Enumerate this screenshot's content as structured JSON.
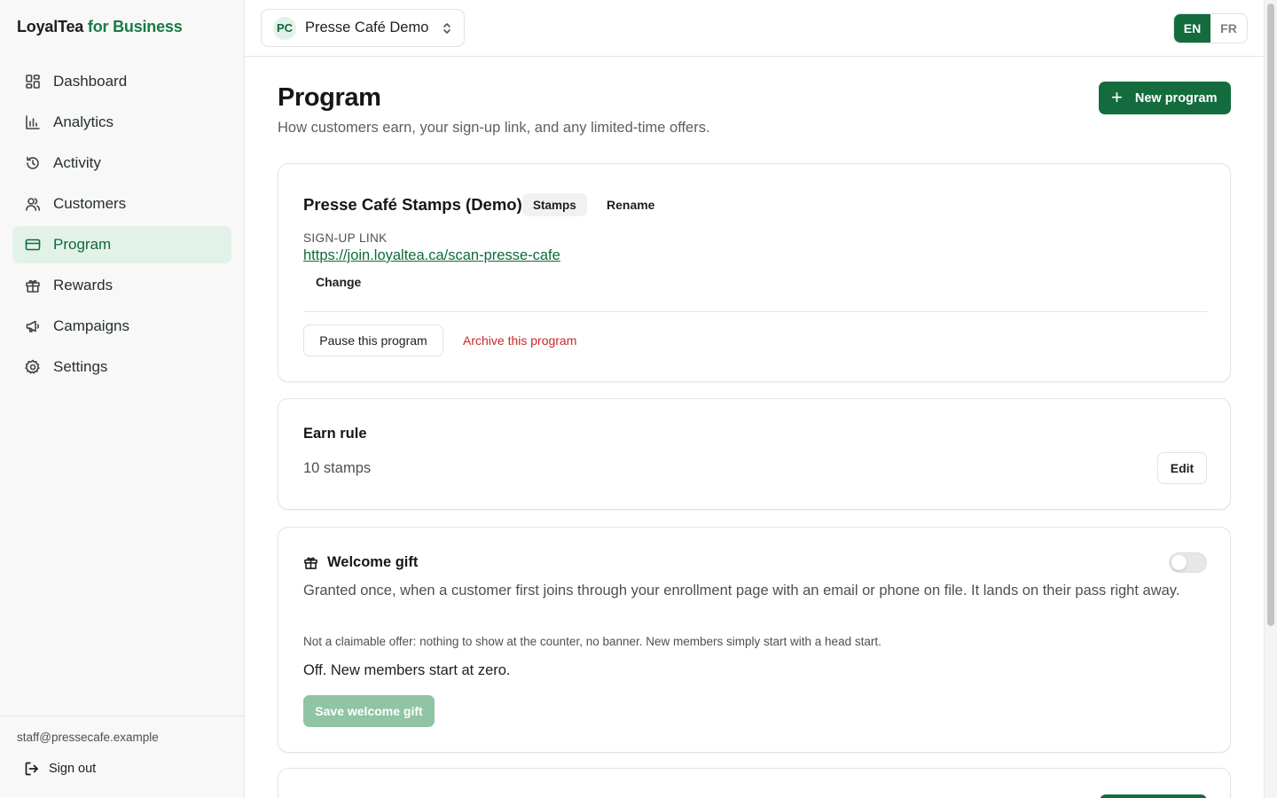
{
  "brand": {
    "name": "LoyalTea",
    "suffix": "for Business"
  },
  "sidebar": {
    "items": [
      {
        "label": "Dashboard",
        "icon": "dashboard-icon"
      },
      {
        "label": "Analytics",
        "icon": "analytics-icon"
      },
      {
        "label": "Activity",
        "icon": "activity-icon"
      },
      {
        "label": "Customers",
        "icon": "customers-icon"
      },
      {
        "label": "Program",
        "icon": "program-icon",
        "active": true
      },
      {
        "label": "Rewards",
        "icon": "rewards-icon"
      },
      {
        "label": "Campaigns",
        "icon": "campaigns-icon"
      },
      {
        "label": "Settings",
        "icon": "settings-icon"
      }
    ],
    "user_email": "staff@pressecafe.example",
    "signout_label": "Sign out"
  },
  "topbar": {
    "business_initials": "PC",
    "business_name": "Presse Café Demo",
    "lang_en": "EN",
    "lang_fr": "FR",
    "active_lang": "EN"
  },
  "page": {
    "title": "Program",
    "subtitle": "How customers earn, your sign-up link, and any limited-time offers.",
    "new_program_label": "New program"
  },
  "program_card": {
    "name": "Presse Café Stamps (Demo)",
    "type_badge": "Stamps",
    "rename_label": "Rename",
    "signup_label": "SIGN-UP LINK",
    "signup_url": "https://join.loyaltea.ca/scan-presse-cafe",
    "change_label": "Change",
    "pause_label": "Pause this program",
    "archive_label": "Archive this program"
  },
  "earn_card": {
    "title": "Earn rule",
    "value": "10 stamps",
    "edit_label": "Edit"
  },
  "welcome_card": {
    "title": "Welcome gift",
    "enabled": false,
    "description": "Granted once, when a customer first joins through your enrollment page with an email or phone on file. It lands on their pass right away.",
    "note": "Not a claimable offer: nothing to show at the counter, no banner. New members simply start with a head start.",
    "status": "Off. New members start at zero.",
    "save_label": "Save welcome gift"
  },
  "colors": {
    "brand_green": "#146c3e",
    "accent_text": "#1a7a47",
    "active_nav_bg": "#e3f2e8",
    "danger": "#c62828"
  }
}
